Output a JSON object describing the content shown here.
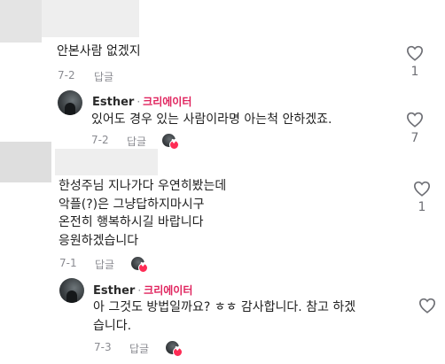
{
  "comments": [
    {
      "text_lines": [
        "안본사람 없겠지"
      ],
      "date": "7-2",
      "reply_label": "답글",
      "likes": "1",
      "reply": {
        "author": "Esther",
        "separator": "·",
        "badge": "크리에이터",
        "text_lines": [
          "있어도 경우 있는 사람이라명 아는척 안하겠죠."
        ],
        "date": "7-2",
        "reply_label": "답글",
        "likes": "7"
      }
    },
    {
      "text_lines": [
        "한성주님 지나가다 우연히봤는데",
        "악플(?)은 그냥답하지마시구",
        "온전히 행복하시길 바랍니다",
        "응원하겠습니다"
      ],
      "date": "7-1",
      "reply_label": "답글",
      "likes": "1",
      "reply": {
        "author": "Esther",
        "separator": "·",
        "badge": "크리에이터",
        "text_lines": [
          "아 그것도 방법일까요? ㅎㅎ 감사합니다. 참고 하겠",
          "습니다."
        ],
        "date": "7-3",
        "reply_label": "답글",
        "likes": ""
      }
    }
  ],
  "icons": {
    "like": "heart-outline-icon",
    "creator_liked": "creator-liked-badge-icon"
  },
  "colors": {
    "creator_badge": "#e0245e",
    "meta_text": "#8a8b91",
    "liked_heart": "#fe2c55"
  }
}
